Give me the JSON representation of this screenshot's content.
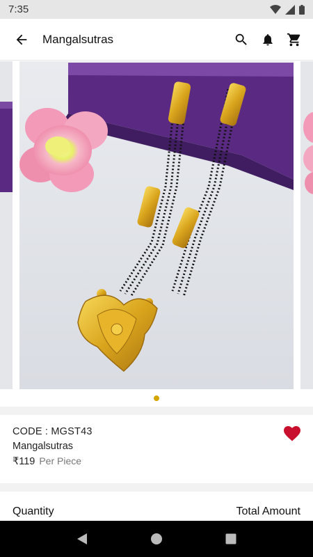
{
  "status_bar": {
    "time": "7:35"
  },
  "app_bar": {
    "title": "Mangalsutras"
  },
  "carousel": {
    "slides": 3,
    "active_index": 0
  },
  "product": {
    "code_label": "CODE : MGST43",
    "name": "Mangalsutras",
    "price": "₹119",
    "unit": "Per Piece",
    "favorited": true
  },
  "quantity": {
    "label": "Quantity",
    "total_label": "Total Amount"
  },
  "colors": {
    "accent": "#d4a600",
    "favorite": "#c8102e",
    "backdrop": "#e2e4e8",
    "velvet": "#5a2a82"
  }
}
